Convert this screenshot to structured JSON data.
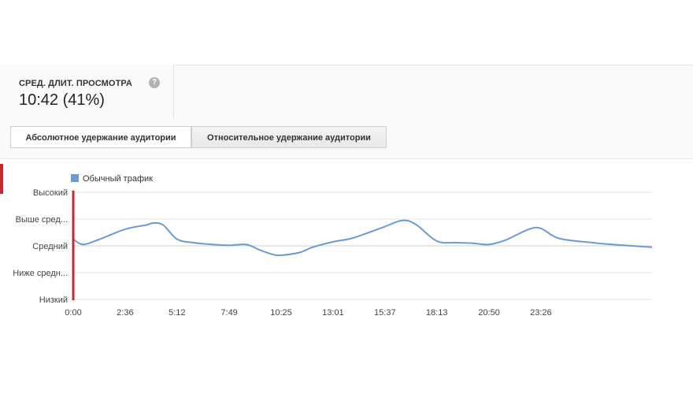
{
  "metric": {
    "label": "СРЕД. ДЛИТ. ПРОСМОТРА",
    "help_icon": "question-circle-icon",
    "value": "10:42 (41%)"
  },
  "tabs": [
    {
      "label": "Абсолютное удержание аудитории",
      "active": true
    },
    {
      "label": "Относительное удержание аудитории",
      "active": false
    }
  ],
  "colors": {
    "series": "#6b9bd2",
    "marker": "#c8282e",
    "grid": "#e6e6e6",
    "average_line": "#cfcfcf"
  },
  "chart_data": {
    "type": "line",
    "legend": "top-left",
    "grid": true,
    "y_categories": [
      "Низкий",
      "Ниже средн...",
      "Средний",
      "Выше сред...",
      "Высокий"
    ],
    "ylim": [
      0,
      4
    ],
    "xlim": [
      0,
      1740
    ],
    "x_tick_labels": [
      "0:00",
      "2:36",
      "5:12",
      "7:49",
      "10:25",
      "13:01",
      "15:37",
      "18:13",
      "20:50",
      "23:26"
    ],
    "x_tick_seconds": [
      0,
      156,
      312,
      469,
      625,
      781,
      937,
      1093,
      1250,
      1406
    ],
    "series": [
      {
        "name": "Обычный трафик",
        "points": [
          [
            0,
            2.25
          ],
          [
            30,
            2.05
          ],
          [
            80,
            2.25
          ],
          [
            156,
            2.62
          ],
          [
            220,
            2.78
          ],
          [
            240,
            2.85
          ],
          [
            270,
            2.78
          ],
          [
            312,
            2.25
          ],
          [
            360,
            2.12
          ],
          [
            420,
            2.05
          ],
          [
            469,
            2.02
          ],
          [
            520,
            2.05
          ],
          [
            560,
            1.85
          ],
          [
            600,
            1.68
          ],
          [
            625,
            1.65
          ],
          [
            680,
            1.75
          ],
          [
            720,
            1.95
          ],
          [
            781,
            2.15
          ],
          [
            837,
            2.28
          ],
          [
            900,
            2.55
          ],
          [
            937,
            2.72
          ],
          [
            990,
            2.95
          ],
          [
            1030,
            2.8
          ],
          [
            1093,
            2.18
          ],
          [
            1150,
            2.12
          ],
          [
            1200,
            2.1
          ],
          [
            1250,
            2.05
          ],
          [
            1300,
            2.22
          ],
          [
            1370,
            2.62
          ],
          [
            1406,
            2.65
          ],
          [
            1460,
            2.28
          ],
          [
            1560,
            2.12
          ],
          [
            1620,
            2.05
          ],
          [
            1740,
            1.95
          ]
        ]
      }
    ]
  }
}
